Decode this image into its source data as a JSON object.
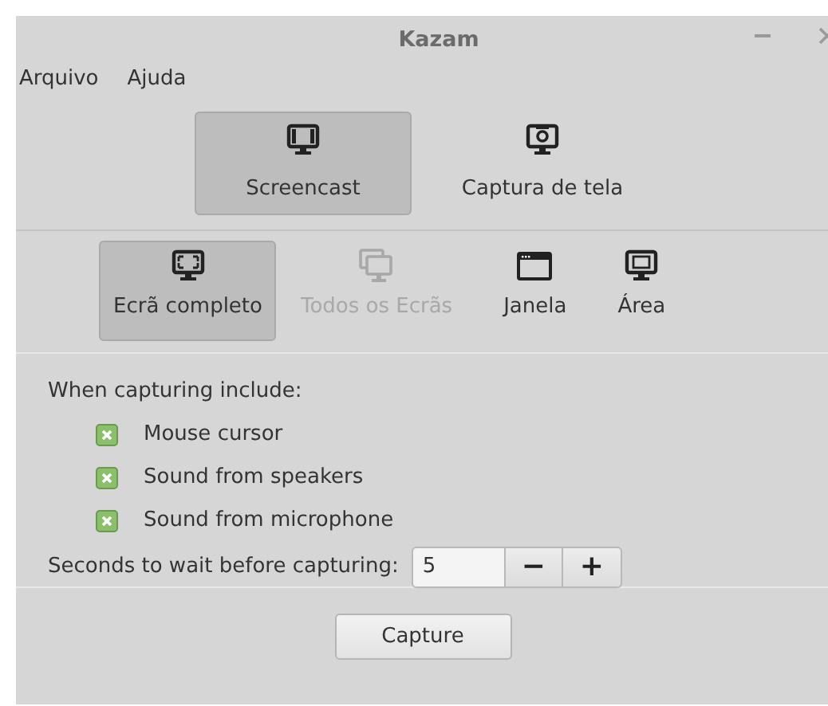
{
  "window": {
    "title": "Kazam"
  },
  "menu": [
    {
      "label": "Arquivo"
    },
    {
      "label": "Ajuda"
    }
  ],
  "modes": [
    {
      "label": "Screencast",
      "selected": true,
      "kind": "screencast"
    },
    {
      "label": "Captura de tela",
      "selected": false,
      "kind": "screenshot"
    }
  ],
  "sources": [
    {
      "label": "Ecrã completo",
      "selected": true,
      "disabled": false,
      "kind": "fullscreen"
    },
    {
      "label": "Todos os Ecrãs",
      "selected": false,
      "disabled": true,
      "kind": "allscreens"
    },
    {
      "label": "Janela",
      "selected": false,
      "disabled": false,
      "kind": "window"
    },
    {
      "label": "Área",
      "selected": false,
      "disabled": false,
      "kind": "area"
    }
  ],
  "include": {
    "heading": "When capturing include:",
    "options": [
      {
        "label": "Mouse cursor",
        "checked": true
      },
      {
        "label": "Sound from speakers",
        "checked": true
      },
      {
        "label": "Sound from microphone",
        "checked": true
      }
    ]
  },
  "delay": {
    "label": "Seconds to wait before capturing:",
    "value": "5",
    "decrease": "−",
    "increase": "+"
  },
  "capture_button": "Capture"
}
